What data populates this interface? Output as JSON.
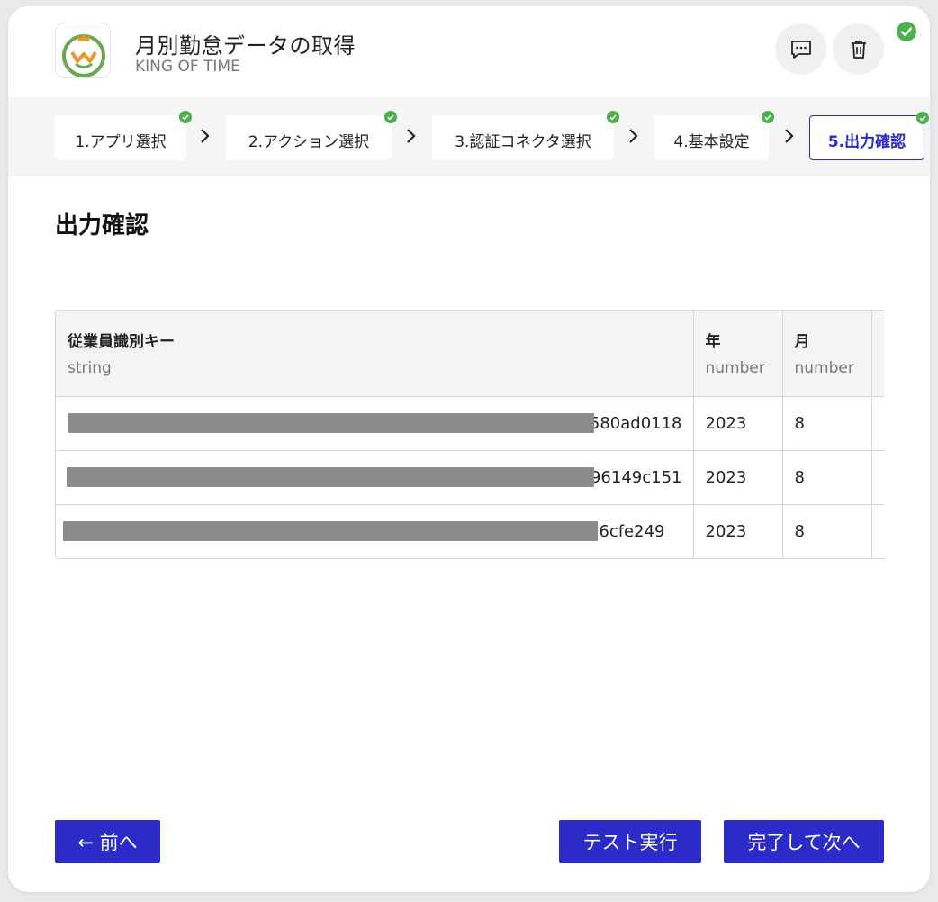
{
  "header": {
    "title": "月別勤怠データの取得",
    "subtitle": "KING OF TIME",
    "logo_icon": "king-of-time-logo"
  },
  "steps": [
    {
      "label": "1.アプリ選択",
      "done": true
    },
    {
      "label": "2.アクション選択",
      "done": true
    },
    {
      "label": "3.認証コネクタ選択",
      "done": true
    },
    {
      "label": "4.基本設定",
      "done": true
    },
    {
      "label": "5.出力確認",
      "done": true,
      "active": true
    }
  ],
  "section_title": "出力確認",
  "table": {
    "columns": [
      {
        "name": "従業員識別キー",
        "type": "string"
      },
      {
        "name": "年",
        "type": "number"
      },
      {
        "name": "月",
        "type": "number"
      }
    ],
    "rows": [
      {
        "key_suffix": "580ad0118",
        "year": "2023",
        "month": "8"
      },
      {
        "key_suffix": "96149c151",
        "year": "2023",
        "month": "8"
      },
      {
        "key_suffix": "06cfe249",
        "year": "2023",
        "month": "8"
      }
    ]
  },
  "footer": {
    "prev_label": "← 前へ",
    "test_label": "テスト実行",
    "next_label": "完了して次へ"
  },
  "colors": {
    "accent": "#2b2bc9",
    "success": "#4caf50",
    "redaction": "#8c8c8c"
  }
}
